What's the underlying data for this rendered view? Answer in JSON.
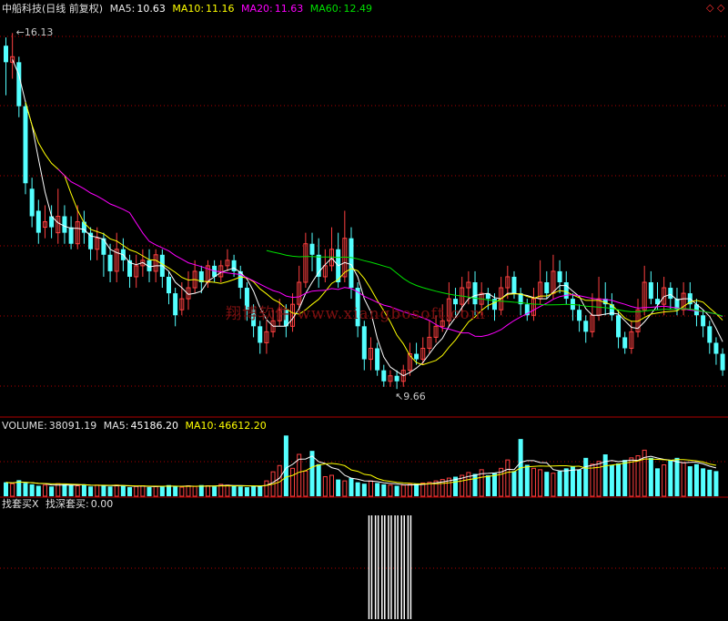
{
  "header": {
    "stock": "中船科技(日线 前复权)",
    "ma5_label": "MA5:",
    "ma5_value": "10.63",
    "ma10_label": "MA10:",
    "ma10_value": "11.16",
    "ma20_label": "MA20:",
    "ma20_value": "11.63",
    "ma60_label": "MA60:",
    "ma60_value": "12.49"
  },
  "volume_header": {
    "vol_label": "VOLUME:",
    "vol_value": "38091.19",
    "ma5_label": "MA5:",
    "ma5_value": "45186.20",
    "ma10_label": "MA10:",
    "ma10_value": "46612.20"
  },
  "indicator_header": {
    "name": "找套买X",
    "series_label": "找深套买:",
    "series_value": "0.00"
  },
  "corner_icons": [
    "diamond-icon",
    "diamond-icon"
  ],
  "watermark": "翔博软件 www.xiangbosoft.com",
  "colors": {
    "up": "#ff4040",
    "down": "#54ffff",
    "ma5": "#ffffff",
    "ma10": "#ffff00",
    "ma20": "#ff00ff",
    "ma60": "#00e000",
    "axis": "#b00000",
    "indicator": "#ffffff"
  },
  "chart_data": [
    {
      "type": "candlestick",
      "title": "中船科技(日线 前复权)",
      "ylim": [
        9.2,
        16.4
      ],
      "annotations": [
        {
          "text": "16.13",
          "candle_index": 1,
          "value": 16.13
        },
        {
          "text": "9.66",
          "candle_index": 60,
          "value": 9.66
        }
      ],
      "candles": [
        [
          15.9,
          15.6,
          16.05,
          15.0
        ],
        [
          15.6,
          15.7,
          16.13,
          15.3
        ],
        [
          15.6,
          14.8,
          15.7,
          14.6
        ],
        [
          14.8,
          13.4,
          14.9,
          13.2
        ],
        [
          13.3,
          12.8,
          13.5,
          12.6
        ],
        [
          12.9,
          12.5,
          13.1,
          12.3
        ],
        [
          12.6,
          12.7,
          13.0,
          12.4
        ],
        [
          12.8,
          12.6,
          13.0,
          12.4
        ],
        [
          12.5,
          12.8,
          13.3,
          12.3
        ],
        [
          12.8,
          12.5,
          13.0,
          12.3
        ],
        [
          12.6,
          12.3,
          12.8,
          12.2
        ],
        [
          12.3,
          12.7,
          13.0,
          12.2
        ],
        [
          12.7,
          12.5,
          12.9,
          12.3
        ],
        [
          12.5,
          12.2,
          12.6,
          12.0
        ],
        [
          12.2,
          12.4,
          12.6,
          12.0
        ],
        [
          12.4,
          12.1,
          12.5,
          11.7
        ],
        [
          12.1,
          11.8,
          12.3,
          11.6
        ],
        [
          11.8,
          12.2,
          12.5,
          11.6
        ],
        [
          12.2,
          12.0,
          12.4,
          11.8
        ],
        [
          12.0,
          11.7,
          12.1,
          11.5
        ],
        [
          11.7,
          11.9,
          12.1,
          11.5
        ],
        [
          11.9,
          12.0,
          12.2,
          11.7
        ],
        [
          12.0,
          11.8,
          12.2,
          11.6
        ],
        [
          11.8,
          12.1,
          12.2,
          11.6
        ],
        [
          12.1,
          11.7,
          12.2,
          11.5
        ],
        [
          11.7,
          11.4,
          11.8,
          11.2
        ],
        [
          11.4,
          11.0,
          11.5,
          10.8
        ],
        [
          11.1,
          11.3,
          11.6,
          11.0
        ],
        [
          11.3,
          11.5,
          11.8,
          11.1
        ],
        [
          11.5,
          11.8,
          12.0,
          11.4
        ],
        [
          11.8,
          11.6,
          11.9,
          11.4
        ],
        [
          11.6,
          11.9,
          12.0,
          11.5
        ],
        [
          11.9,
          11.7,
          12.0,
          11.6
        ],
        [
          11.7,
          11.9,
          12.0,
          11.6
        ],
        [
          11.9,
          12.0,
          12.2,
          11.8
        ],
        [
          12.0,
          11.8,
          12.1,
          11.7
        ],
        [
          11.8,
          11.5,
          11.9,
          11.3
        ],
        [
          11.5,
          11.1,
          11.6,
          10.9
        ],
        [
          11.1,
          10.8,
          11.2,
          10.6
        ],
        [
          10.8,
          10.5,
          10.9,
          10.3
        ],
        [
          10.5,
          10.7,
          10.9,
          10.3
        ],
        [
          10.7,
          10.9,
          11.1,
          10.6
        ],
        [
          10.9,
          11.1,
          11.3,
          10.8
        ],
        [
          11.1,
          10.8,
          11.2,
          10.6
        ],
        [
          10.8,
          11.2,
          11.4,
          10.7
        ],
        [
          11.2,
          11.6,
          11.9,
          11.1
        ],
        [
          11.6,
          12.3,
          12.5,
          11.5
        ],
        [
          12.3,
          12.1,
          12.5,
          11.8
        ],
        [
          12.1,
          11.7,
          12.4,
          11.5
        ],
        [
          11.7,
          11.9,
          12.2,
          11.6
        ],
        [
          11.9,
          12.2,
          12.6,
          11.8
        ],
        [
          12.2,
          11.6,
          12.5,
          11.5
        ],
        [
          11.7,
          12.4,
          12.9,
          11.6
        ],
        [
          12.4,
          11.5,
          12.6,
          11.3
        ],
        [
          11.5,
          10.8,
          11.6,
          10.6
        ],
        [
          10.8,
          10.2,
          10.9,
          10.0
        ],
        [
          10.2,
          10.4,
          10.6,
          10.0
        ],
        [
          10.4,
          10.0,
          10.5,
          9.9
        ],
        [
          10.0,
          9.8,
          10.1,
          9.7
        ],
        [
          9.8,
          9.9,
          10.0,
          9.7
        ],
        [
          9.9,
          9.8,
          10.0,
          9.66
        ],
        [
          9.8,
          10.0,
          10.1,
          9.7
        ],
        [
          10.0,
          10.3,
          10.5,
          9.9
        ],
        [
          10.3,
          10.2,
          10.5,
          10.1
        ],
        [
          10.2,
          10.4,
          10.6,
          10.1
        ],
        [
          10.4,
          10.6,
          10.9,
          10.3
        ],
        [
          10.6,
          10.8,
          11.0,
          10.5
        ],
        [
          10.8,
          10.9,
          11.2,
          10.7
        ],
        [
          10.9,
          11.3,
          11.6,
          10.8
        ],
        [
          11.3,
          11.2,
          11.5,
          11.0
        ],
        [
          11.2,
          11.5,
          11.7,
          11.0
        ],
        [
          11.5,
          11.6,
          11.8,
          11.2
        ],
        [
          11.6,
          11.2,
          11.8,
          11.0
        ],
        [
          11.2,
          11.4,
          11.6,
          11.0
        ],
        [
          11.4,
          11.3,
          11.5,
          11.1
        ],
        [
          11.3,
          11.1,
          11.4,
          10.9
        ],
        [
          11.1,
          11.5,
          11.7,
          11.0
        ],
        [
          11.5,
          11.7,
          11.9,
          11.3
        ],
        [
          11.7,
          11.4,
          11.8,
          11.3
        ],
        [
          11.4,
          11.2,
          11.5,
          11.0
        ],
        [
          11.2,
          11.0,
          11.3,
          10.9
        ],
        [
          11.0,
          11.3,
          11.5,
          10.9
        ],
        [
          11.3,
          11.6,
          12.0,
          11.2
        ],
        [
          11.6,
          11.4,
          11.8,
          11.3
        ],
        [
          11.4,
          11.8,
          12.1,
          11.3
        ],
        [
          11.8,
          11.6,
          12.0,
          11.4
        ],
        [
          11.6,
          11.3,
          11.8,
          11.2
        ],
        [
          11.3,
          11.1,
          11.4,
          10.9
        ],
        [
          11.1,
          10.9,
          11.2,
          10.7
        ],
        [
          10.9,
          10.7,
          11.0,
          10.5
        ],
        [
          10.7,
          11.0,
          11.4,
          10.6
        ],
        [
          11.0,
          11.3,
          11.7,
          10.9
        ],
        [
          11.3,
          11.2,
          11.6,
          11.0
        ],
        [
          11.2,
          11.0,
          11.4,
          10.9
        ],
        [
          11.0,
          10.6,
          11.1,
          10.4
        ],
        [
          10.6,
          10.4,
          10.7,
          10.3
        ],
        [
          10.4,
          10.7,
          10.9,
          10.3
        ],
        [
          10.7,
          11.1,
          11.3,
          10.6
        ],
        [
          11.1,
          11.6,
          11.9,
          11.0
        ],
        [
          11.6,
          11.3,
          11.8,
          11.2
        ],
        [
          11.3,
          11.2,
          11.6,
          11.1
        ],
        [
          11.2,
          11.5,
          11.7,
          11.0
        ],
        [
          11.5,
          11.3,
          11.6,
          11.1
        ],
        [
          11.3,
          11.1,
          11.5,
          11.0
        ],
        [
          11.1,
          11.4,
          11.6,
          11.0
        ],
        [
          11.4,
          11.2,
          11.6,
          11.1
        ],
        [
          11.2,
          11.0,
          11.3,
          10.8
        ],
        [
          11.0,
          10.8,
          11.1,
          10.6
        ],
        [
          10.8,
          10.5,
          10.9,
          10.3
        ],
        [
          10.5,
          10.3,
          10.6,
          10.1
        ],
        [
          10.3,
          10.0,
          10.4,
          9.9
        ]
      ]
    },
    {
      "type": "bar",
      "title": "VOLUME",
      "ylim": [
        0,
        90000
      ],
      "values": [
        20000,
        18000,
        23000,
        19000,
        17000,
        15000,
        16000,
        14000,
        18000,
        17000,
        16000,
        15000,
        17000,
        14000,
        16000,
        15000,
        14000,
        16000,
        15000,
        13000,
        14000,
        15000,
        13000,
        14000,
        15000,
        16000,
        14000,
        13000,
        15000,
        14000,
        16000,
        15000,
        14000,
        17000,
        16000,
        15000,
        14000,
        13000,
        15000,
        14000,
        22000,
        35000,
        44000,
        87000,
        40000,
        60000,
        36000,
        65000,
        46000,
        28000,
        30000,
        24000,
        22000,
        26000,
        20000,
        18000,
        22000,
        19000,
        17000,
        16000,
        15000,
        16000,
        17000,
        18000,
        19000,
        20000,
        22000,
        24000,
        26000,
        28000,
        30000,
        34000,
        32000,
        38000,
        30000,
        33000,
        40000,
        52000,
        36000,
        82000,
        45000,
        40000,
        38000,
        35000,
        33000,
        36000,
        40000,
        43000,
        38000,
        55000,
        46000,
        50000,
        60000,
        45000,
        47000,
        52000,
        55000,
        58000,
        66000,
        55000,
        40000,
        45000,
        52000,
        55000,
        48000,
        43000,
        46000,
        40000,
        38000,
        36000
      ]
    },
    {
      "type": "bar",
      "title": "找套买X",
      "ylim": [
        0,
        1
      ],
      "values": [
        0,
        0,
        0,
        0,
        0,
        0,
        1,
        1,
        1,
        1,
        1,
        1,
        1,
        0,
        0,
        0,
        0,
        0,
        0,
        0
      ],
      "window_start": 50
    }
  ]
}
